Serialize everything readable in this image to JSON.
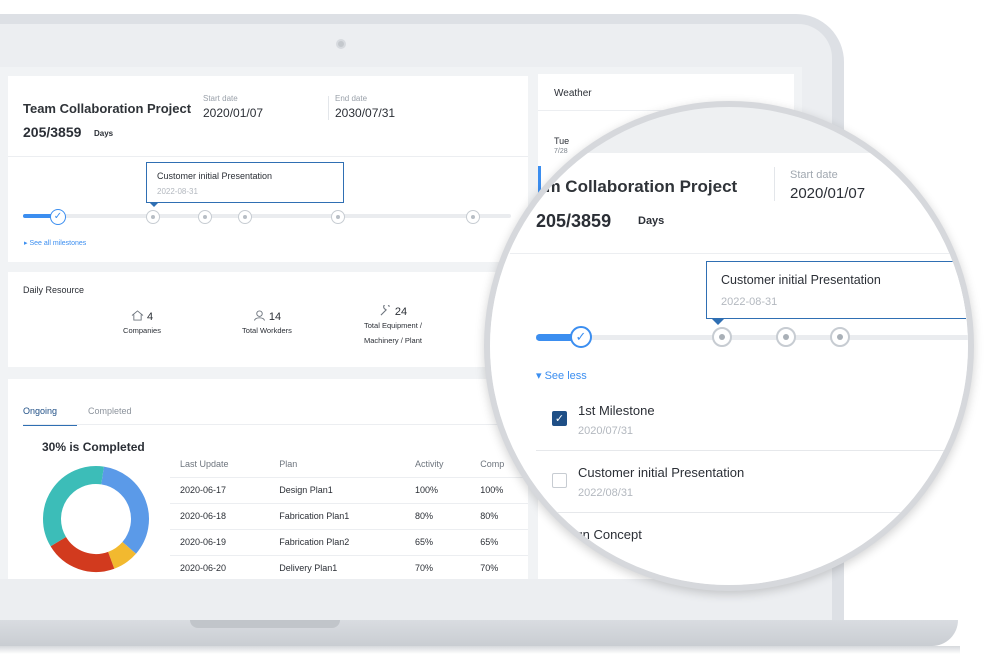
{
  "project": {
    "title": "Team Collaboration Project",
    "days": "205/3859",
    "days_label": "Days",
    "start_label": "Start date",
    "start_value": "2020/01/07",
    "end_label": "End date",
    "end_value": "2030/07/31",
    "tooltip_title": "Customer initial Presentation",
    "tooltip_date": "2022-08-31",
    "see_all": "See all milestones",
    "progress_fraction": 0.05
  },
  "resource": {
    "title": "Daily Resource",
    "items": [
      {
        "value": "4",
        "label": "Companies",
        "icon": "house-icon"
      },
      {
        "value": "14",
        "label": "Total Workders",
        "icon": "person-icon"
      },
      {
        "value": "24",
        "label": "Total Equipment /",
        "label2": "Machinery / Plant",
        "icon": "wrench-icon"
      }
    ]
  },
  "progress": {
    "tabs": [
      "Ongoing",
      "Completed"
    ],
    "completed_text": "30% is Completed",
    "columns": [
      "Last Update",
      "Plan",
      "Activity",
      "Comp"
    ],
    "rows": [
      [
        "2020-06-17",
        "Design Plan1",
        "100%",
        "100%"
      ],
      [
        "2020-06-18",
        "Fabrication Plan1",
        "80%",
        "80%"
      ],
      [
        "2020-06-19",
        "Fabrication Plan2",
        "65%",
        "65%"
      ],
      [
        "2020-06-20",
        "Delivery Plan1",
        "70%",
        "70%"
      ]
    ],
    "donut": {
      "segments": [
        {
          "color": "#5b9ae8",
          "fraction": 0.34
        },
        {
          "color": "#f2b92f",
          "fraction": 0.08
        },
        {
          "color": "#d23a1e",
          "fraction": 0.22
        },
        {
          "color": "#3cbdb8",
          "fraction": 0.36
        }
      ]
    }
  },
  "weather": {
    "title": "Weather",
    "day": "Tue",
    "date": "7/28"
  },
  "magnifier": {
    "title": "am Collaboration Project",
    "start_label": "Start date",
    "start_value": "2020/01/07",
    "days": "205/3859",
    "days_label": "Days",
    "tooltip_title": "Customer initial Presentation",
    "tooltip_date": "2022-08-31",
    "see_less": "See less",
    "milestones": [
      {
        "name": "1st Milestone",
        "date": "2020/07/31",
        "checked": true
      },
      {
        "name": "Customer initial Presentation",
        "date": "2022/08/31",
        "checked": false
      },
      {
        "name": "sign Concept",
        "date": "",
        "checked": false
      }
    ]
  },
  "colors": {
    "accent": "#3b8ef0",
    "primary_dark": "#1f4f86",
    "shell": "#dde0e5"
  }
}
